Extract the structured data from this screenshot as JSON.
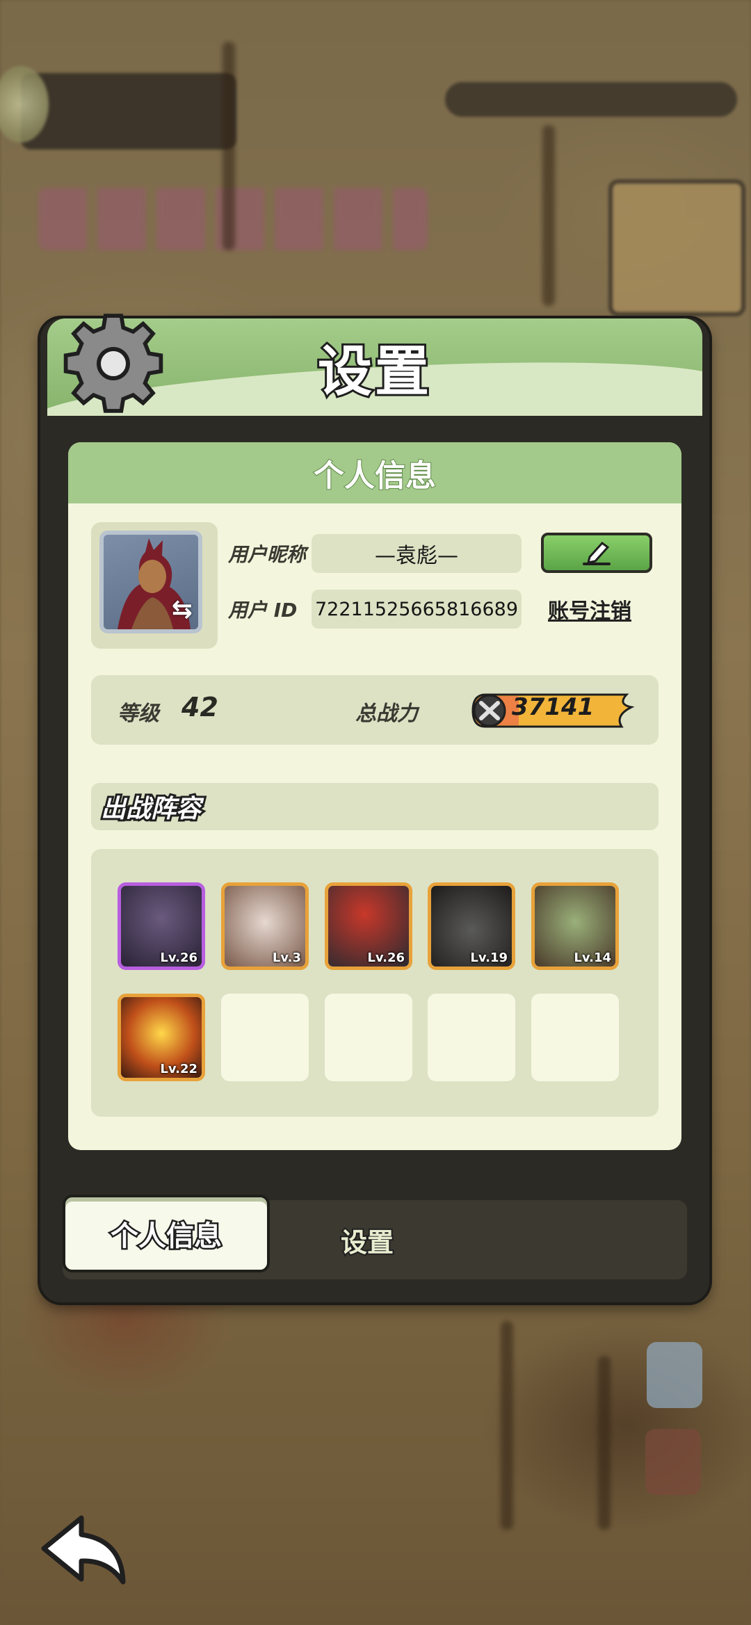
{
  "panel": {
    "title": "设置"
  },
  "profile": {
    "section_title": "个人信息",
    "nickname_label": "用户昵称",
    "nickname_value": "—袁彪—",
    "id_label": "用户  ID",
    "id_value": "72211525665816689",
    "delete_account_label": "账号注销"
  },
  "stats": {
    "level_label": "等级",
    "level_value": "42",
    "power_label": "总战力",
    "power_value": "37141"
  },
  "lineup": {
    "title": "出战阵容",
    "heroes": [
      {
        "level": "Lv.26",
        "frame": "purple",
        "color": "#4a3a5e"
      },
      {
        "level": "Lv.3",
        "frame": "orange",
        "color": "#8a6a5a"
      },
      {
        "level": "Lv.26",
        "frame": "orange",
        "color": "#4a3a38"
      },
      {
        "level": "Lv.19",
        "frame": "orange",
        "color": "#3d3a35"
      },
      {
        "level": "Lv.14",
        "frame": "orange",
        "color": "#6a5a3a"
      },
      {
        "level": "Lv.22",
        "frame": "orange",
        "color": "#a84a1a"
      }
    ]
  },
  "tabs": {
    "active_label": "个人信息",
    "inactive_label": "设置"
  },
  "colors": {
    "header_green": "#a4cc8a",
    "panel_cream": "#f3f6dc",
    "edit_green": "#6bb553",
    "power_orange": "#f2b53a"
  }
}
